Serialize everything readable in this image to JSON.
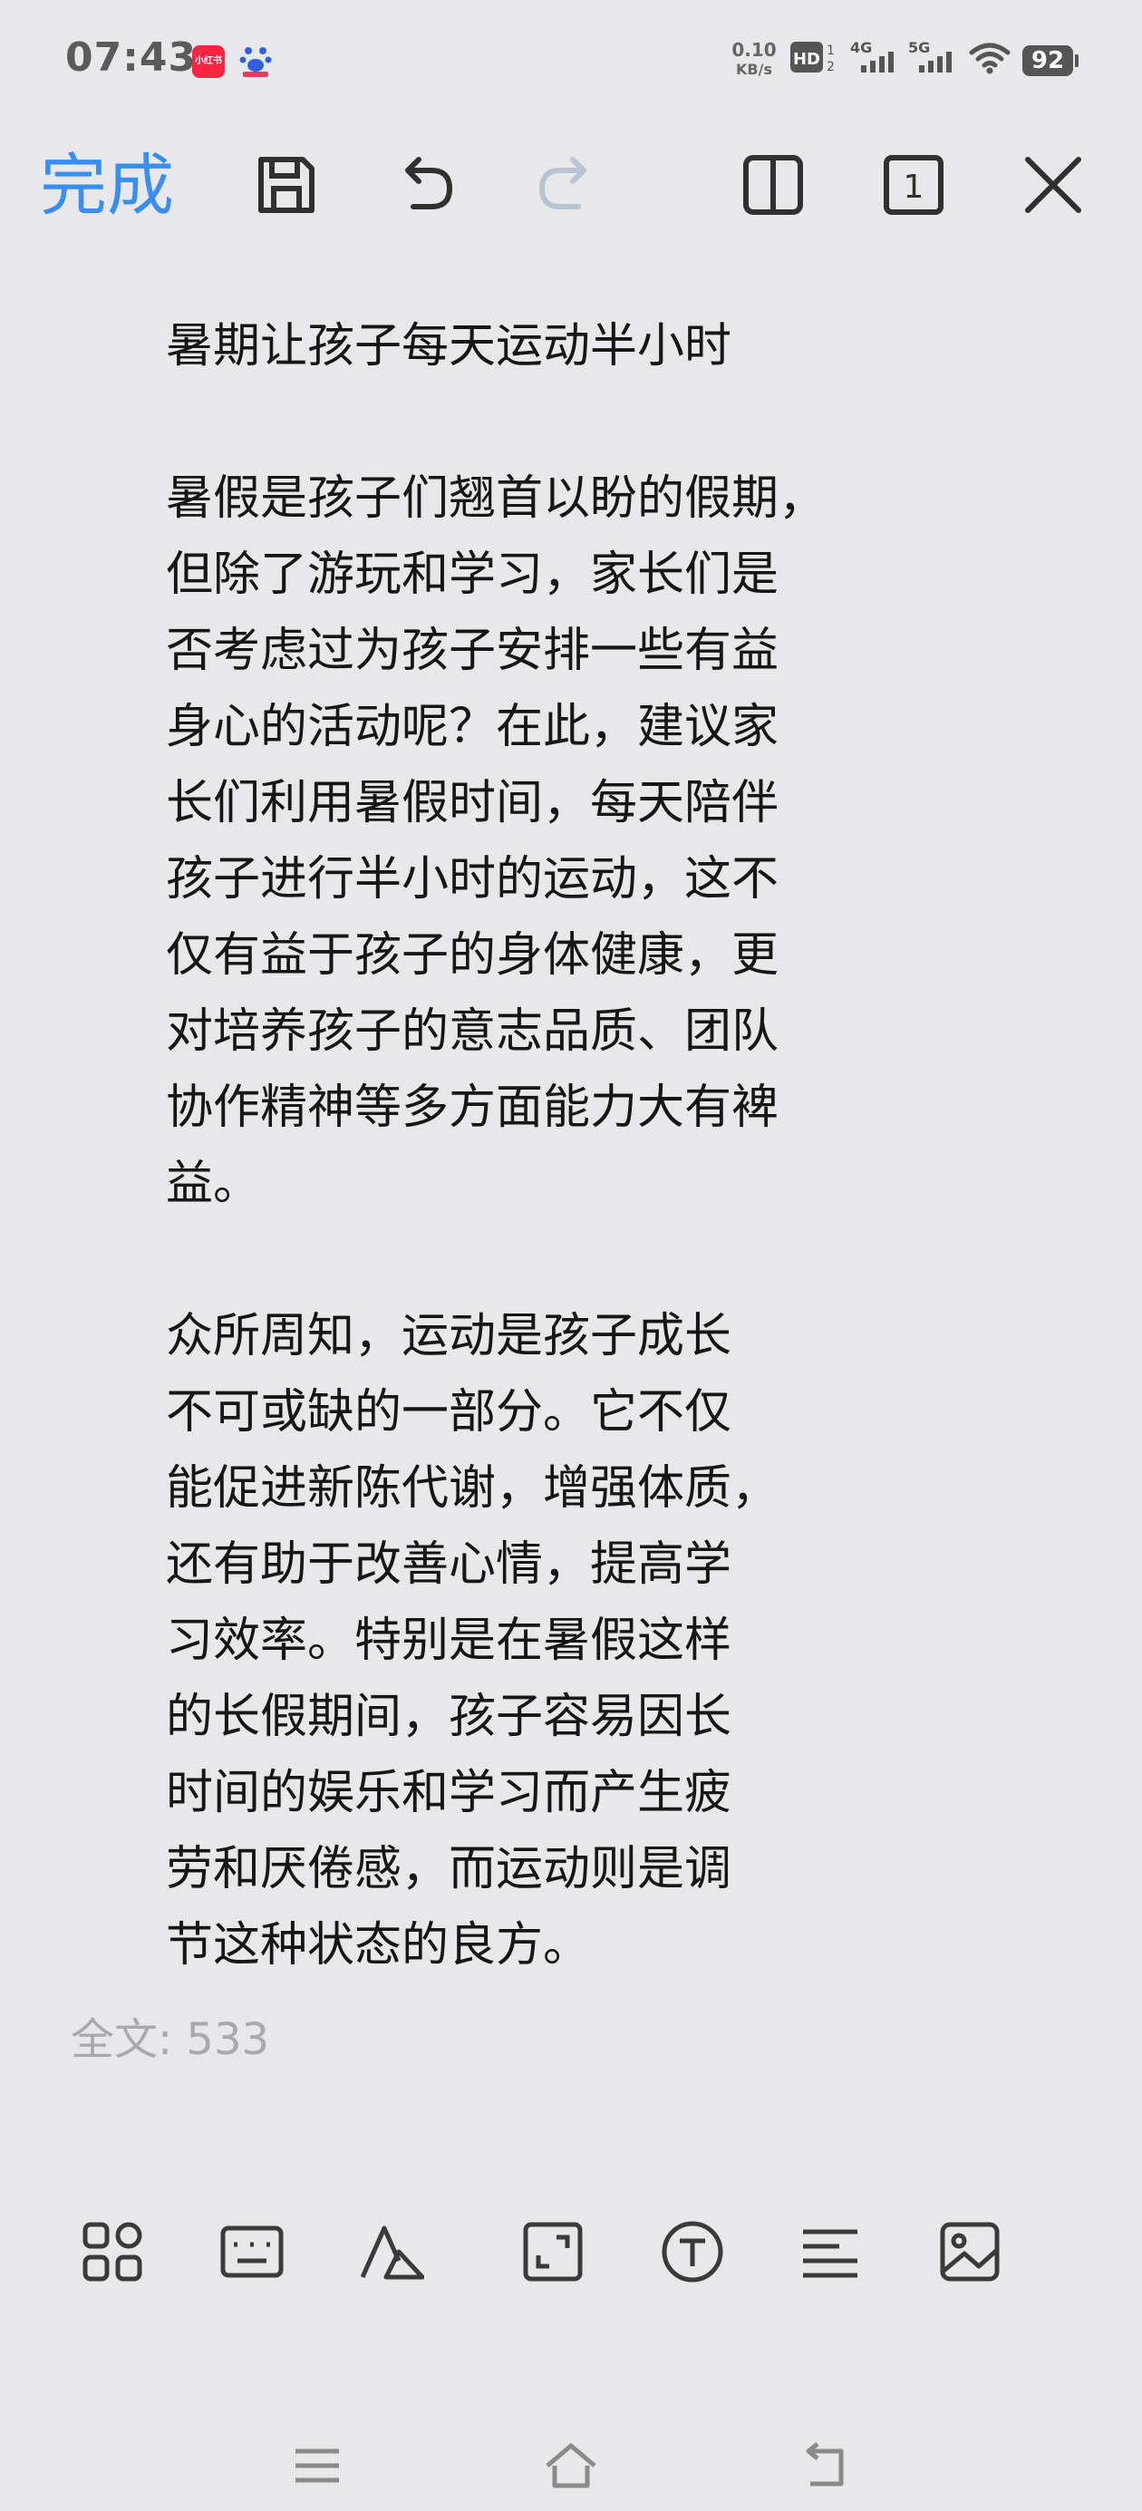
{
  "status_bar": {
    "time": "07:43",
    "app_badge_1": "小红书",
    "net_speed": "0.10",
    "net_unit": "KB/s",
    "hd_label": "HD",
    "sig1_label": "4G",
    "sig2_label": "5G",
    "battery": "92"
  },
  "toolbar": {
    "done_label": "完成",
    "page_number": "1"
  },
  "document": {
    "title": "暑期让孩子每天运动半小时",
    "paragraphs": [
      "暑假是孩子们翘首以盼的假期，\n但除了游玩和学习，家长们是\n否考虑过为孩子安排一些有益\n身心的活动呢？在此，建议家\n长们利用暑假时间，每天陪伴\n孩子进行半小时的运动，这不\n仅有益于孩子的身体健康，更\n对培养孩子的意志品质、团队\n协作精神等多方面能力大有裨\n益。",
      "众所周知，运动是孩子成长\n不可或缺的一部分。它不仅\n能促进新陈代谢，增强体质，\n还有助于改善心情，提高学\n习效率。特别是在暑假这样\n的长假期间，孩子容易因长\n时间的娱乐和学习而产生疲\n劳和厌倦感，而运动则是调\n节这种状态的良方。"
    ]
  },
  "footer": {
    "word_count": "全文: 533"
  },
  "colors": {
    "accent": "#3a8ef0",
    "background": "#e8e8ea",
    "text": "#161616",
    "muted": "#a8a8b0"
  },
  "icons": {
    "toolbar": [
      "save-icon",
      "undo-icon",
      "redo-icon",
      "split-view-icon",
      "page-number-icon",
      "close-icon"
    ],
    "bottom": [
      "apps-grid-icon",
      "keyboard-icon",
      "font-style-icon",
      "expand-icon",
      "text-format-icon",
      "align-left-icon",
      "image-icon"
    ],
    "nav": [
      "menu-icon",
      "home-icon",
      "back-icon"
    ]
  }
}
